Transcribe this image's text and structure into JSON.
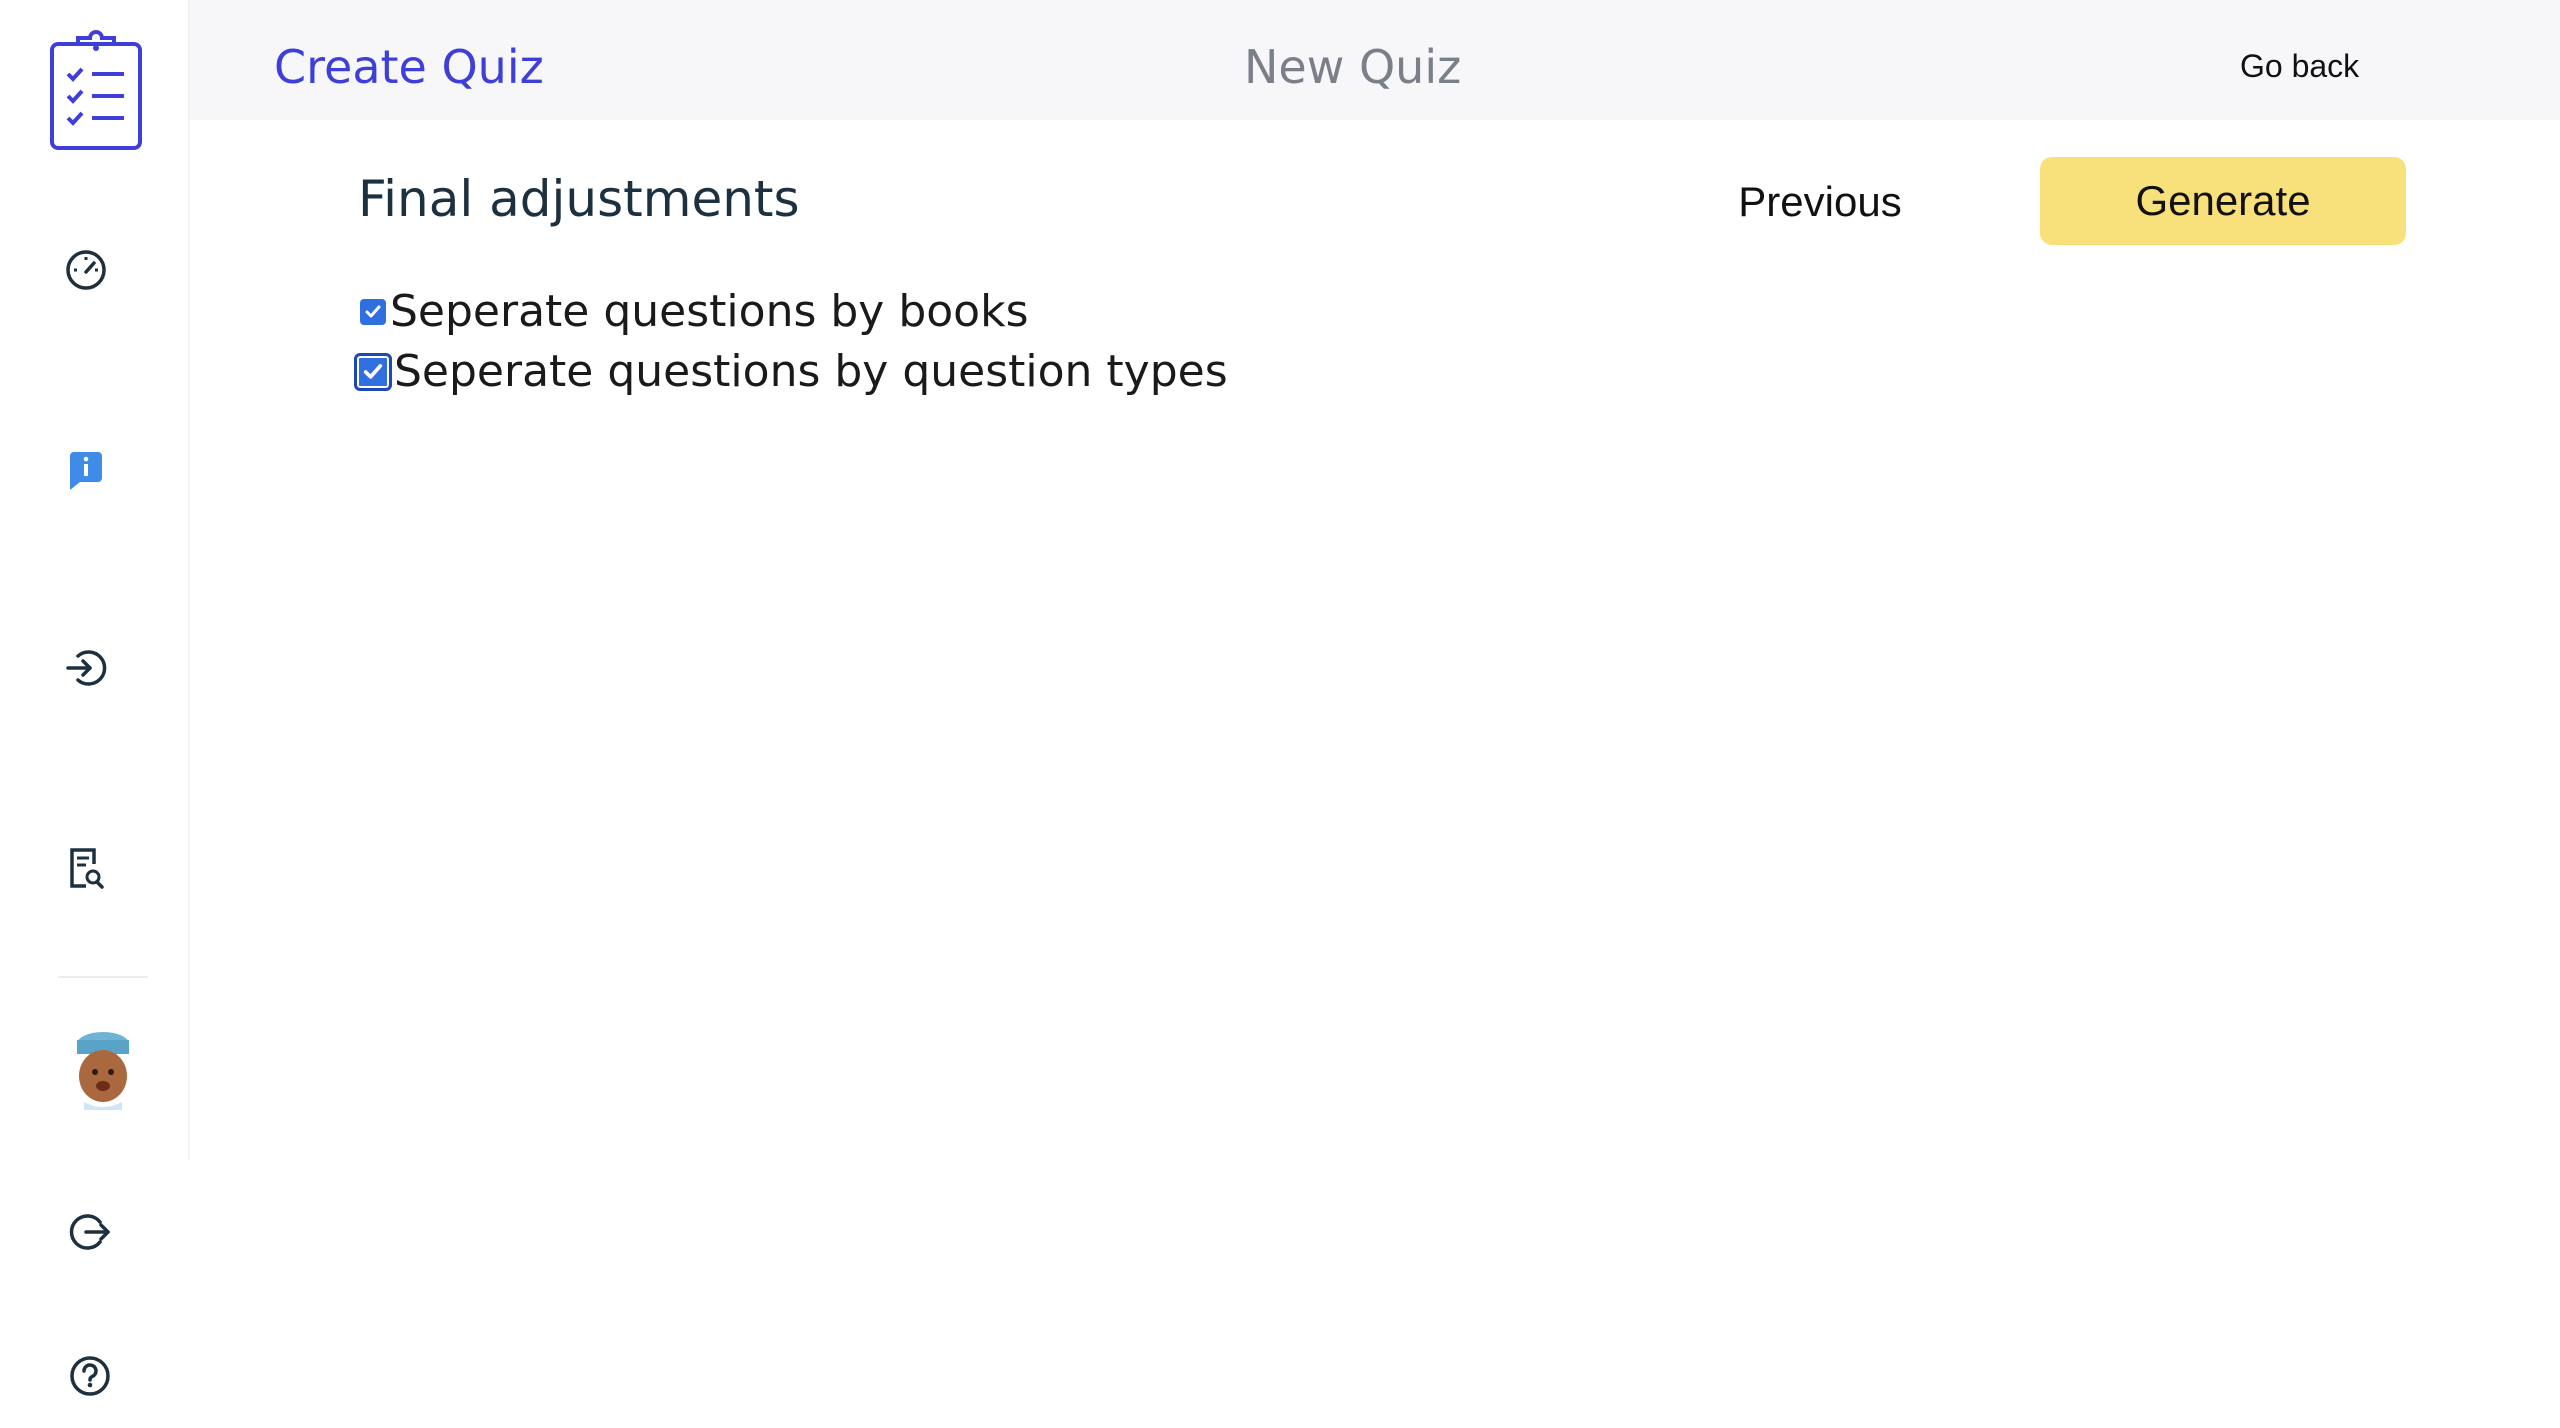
{
  "header": {
    "title": "Create Quiz",
    "center_title": "New Quiz",
    "go_back_label": "Go back"
  },
  "sidebar": {
    "items": [
      {
        "icon": "clipboard-checklist-icon"
      },
      {
        "icon": "dashboard-gauge-icon"
      },
      {
        "icon": "info-chat-icon"
      },
      {
        "icon": "login-icon"
      },
      {
        "icon": "report-search-icon"
      },
      {
        "icon": "user-avatar"
      },
      {
        "icon": "logout-icon"
      },
      {
        "icon": "help-icon"
      }
    ]
  },
  "main": {
    "section_title": "Final adjustments",
    "previous_label": "Previous",
    "generate_label": "Generate",
    "options": [
      {
        "label": "Seperate questions by books",
        "checked": true
      },
      {
        "label": "Seperate questions by question types",
        "checked": true
      }
    ]
  },
  "colors": {
    "accent": "#3e3fd8",
    "generate_button": "#f8e07a",
    "checkbox": "#2f6fe0",
    "header_bg": "#f7f7fa"
  }
}
